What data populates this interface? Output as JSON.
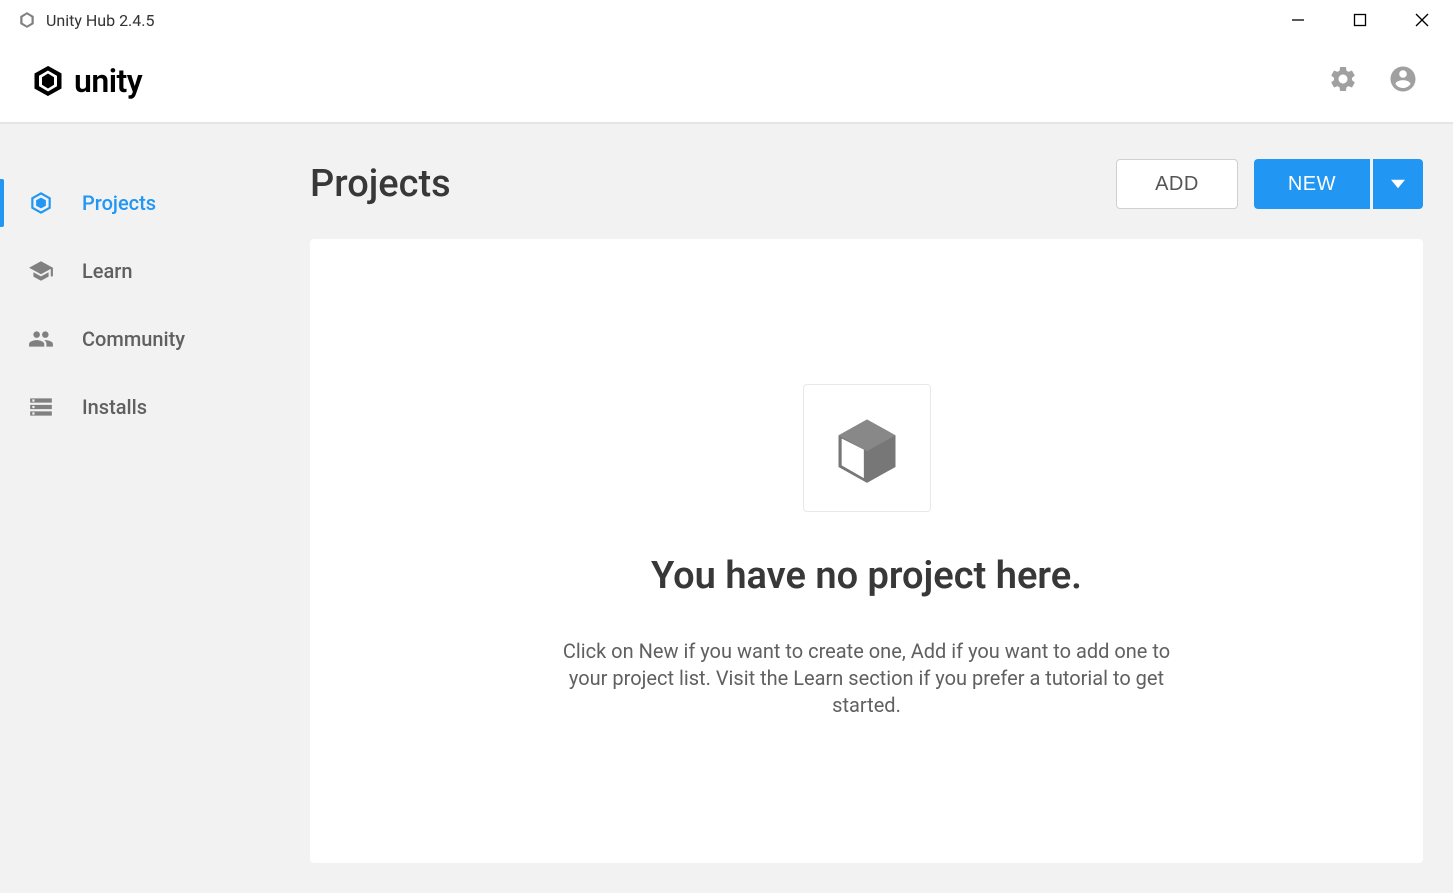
{
  "window": {
    "title": "Unity Hub 2.4.5"
  },
  "header": {
    "logo_text": "unity"
  },
  "sidebar": {
    "items": [
      {
        "label": "Projects",
        "active": true
      },
      {
        "label": "Learn",
        "active": false
      },
      {
        "label": "Community",
        "active": false
      },
      {
        "label": "Installs",
        "active": false
      }
    ]
  },
  "content": {
    "page_title": "Projects",
    "add_button": "ADD",
    "new_button": "NEW",
    "empty_state": {
      "title": "You have no project here.",
      "description": "Click on New if you want to create one, Add if you want to add one to your project list. Visit the Learn section if you prefer a tutorial to get started."
    }
  }
}
